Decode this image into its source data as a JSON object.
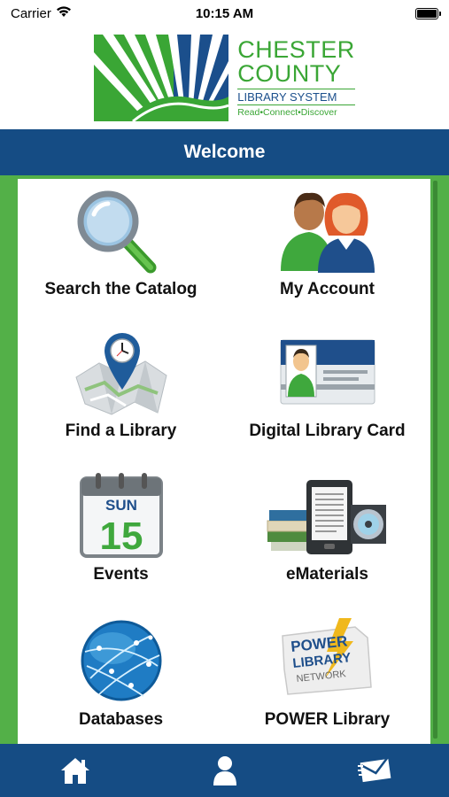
{
  "status_bar": {
    "carrier": "Carrier",
    "time": "10:15 AM",
    "wifi_icon": "wifi-icon",
    "battery_icon": "battery-icon"
  },
  "logo": {
    "line1": "CHESTER",
    "line2": "COUNTY",
    "line3": "LIBRARY SYSTEM",
    "tagline": "Read•Connect•Discover",
    "colors": {
      "green": "#3aa635",
      "blue": "#1b4f8c"
    }
  },
  "header": {
    "title": "Welcome"
  },
  "menu": [
    {
      "label": "Search the Catalog",
      "icon": "magnifying-glass-icon"
    },
    {
      "label": "My Account",
      "icon": "users-icon"
    },
    {
      "label": "Find a Library",
      "icon": "map-pin-icon"
    },
    {
      "label": "Digital Library Card",
      "icon": "library-card-icon"
    },
    {
      "label": "Events",
      "icon": "calendar-icon",
      "calendar_day": "SUN",
      "calendar_date": "15"
    },
    {
      "label": "eMaterials",
      "icon": "ereader-books-icon"
    },
    {
      "label": "Databases",
      "icon": "globe-network-icon"
    },
    {
      "label": "POWER Library",
      "icon": "power-library-logo",
      "logo_text": [
        "POWER",
        "LIBRARY",
        "NETWORK"
      ]
    }
  ],
  "tab_bar": {
    "items": [
      {
        "icon": "home-icon"
      },
      {
        "icon": "person-icon"
      },
      {
        "icon": "mail-icon"
      }
    ]
  },
  "colors": {
    "header_blue": "#154c84",
    "side_green": "#53b048"
  }
}
